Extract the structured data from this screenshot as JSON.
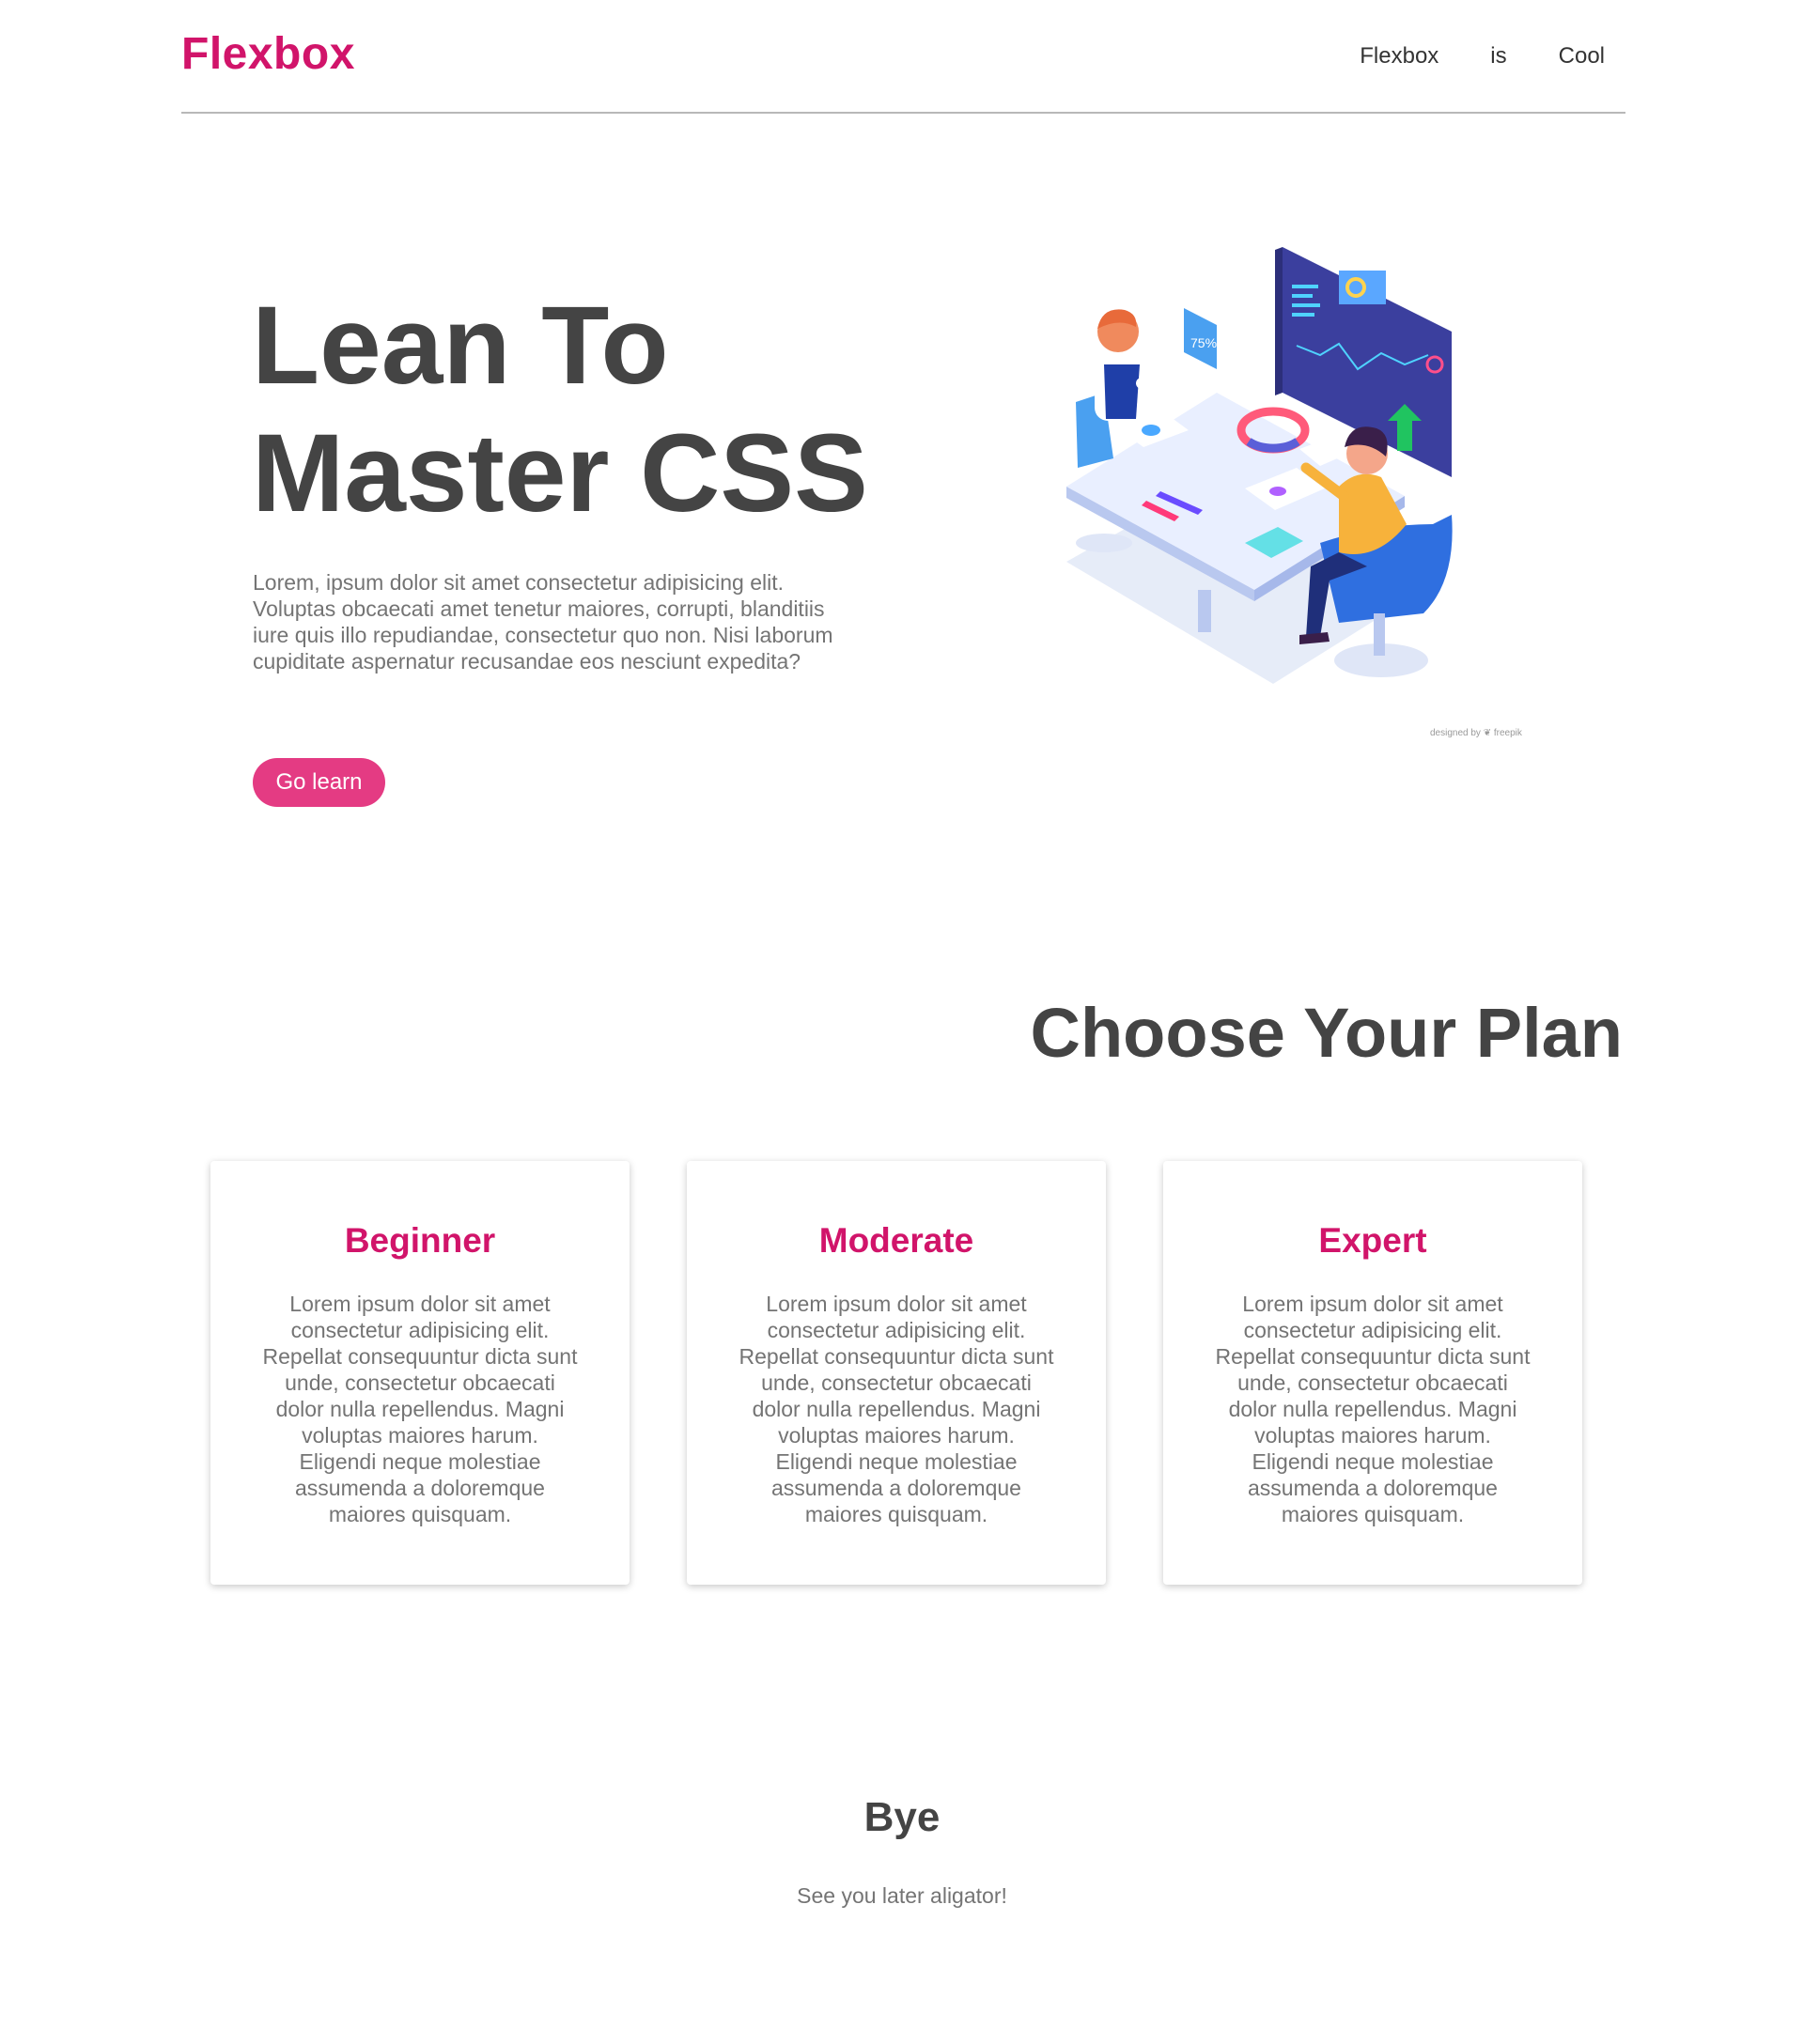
{
  "header": {
    "logo": "Flexbox",
    "nav": [
      "Flexbox",
      "is",
      "Cool"
    ]
  },
  "hero": {
    "title_line1": "Lean To",
    "title_line2": "Master CSS",
    "text": "Lorem, ipsum dolor sit amet consectetur adipisicing elit. Voluptas obcaecati amet tenetur maiores, corrupti, blanditiis iure quis illo repudiandae, consectetur quo non. Nisi laborum cupiditate aspernatur recusandae eos nesciunt expedita?",
    "button": "Go learn",
    "illustration_percent": "75%",
    "credit": "designed by ❦ freepik"
  },
  "plans": {
    "title": "Choose Your Plan",
    "cards": [
      {
        "name": "Beginner",
        "text": "Lorem ipsum dolor sit amet consectetur adipisicing elit. Repellat consequuntur dicta sunt unde, consectetur obcaecati dolor nulla repellendus. Magni voluptas maiores harum. Eligendi neque molestiae assumenda a doloremque maiores quisquam."
      },
      {
        "name": "Moderate",
        "text": "Lorem ipsum dolor sit amet consectetur adipisicing elit. Repellat consequuntur dicta sunt unde, consectetur obcaecati dolor nulla repellendus. Magni voluptas maiores harum. Eligendi neque molestiae assumenda a doloremque maiores quisquam."
      },
      {
        "name": "Expert",
        "text": "Lorem ipsum dolor sit amet consectetur adipisicing elit. Repellat consequuntur dicta sunt unde, consectetur obcaecati dolor nulla repellendus. Magni voluptas maiores harum. Eligendi neque molestiae assumenda a doloremque maiores quisquam."
      }
    ]
  },
  "footer": {
    "title": "Bye",
    "subtitle": "See you later aligator!"
  },
  "colors": {
    "accent": "#d1146a",
    "button": "#e43b83",
    "heading": "#444444",
    "body_text": "#747474"
  }
}
